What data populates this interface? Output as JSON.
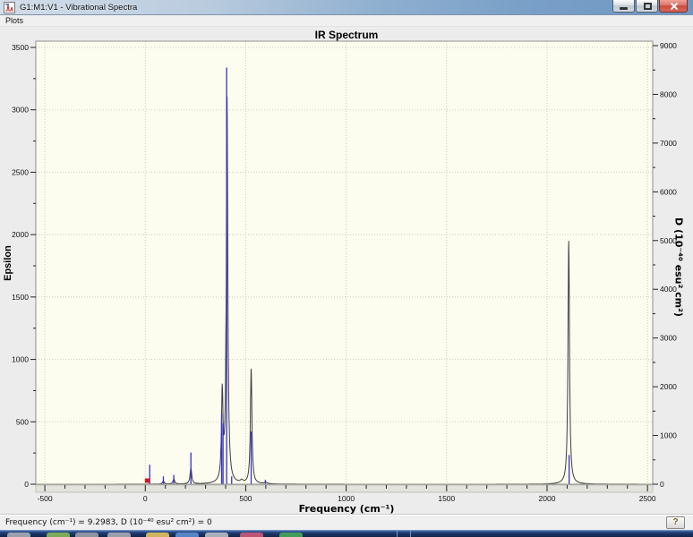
{
  "window": {
    "title": "G1:M1:V1 - Vibrational Spectra"
  },
  "menu": {
    "items": [
      {
        "label": "Plots"
      }
    ]
  },
  "status_bar": {
    "text": "Frequency (cm⁻¹) = 9.2983, D (10⁻⁴⁰ esu² cm²) = 0",
    "help_label": "?"
  },
  "chart_data": {
    "type": "line",
    "title": "IR Spectrum",
    "xlabel": "Frequency (cm⁻¹)",
    "ylabel_left": "Epsilon",
    "ylabel_right": "D (10⁻⁴⁰ esu² cm²)",
    "x_range": [
      -545,
      2526
    ],
    "eps_range": [
      0,
      3550
    ],
    "d_range": [
      0,
      9092
    ],
    "x_ticks": [
      -500,
      0,
      500,
      1000,
      1500,
      2000,
      2500
    ],
    "x_minor_step": 100,
    "eps_ticks": [
      0,
      500,
      1000,
      1500,
      2000,
      2500,
      3000,
      3500
    ],
    "eps_minor_step": 250,
    "d_ticks": [
      0,
      1000,
      2000,
      3000,
      4000,
      5000,
      6000,
      7000,
      8000,
      9000
    ],
    "d_minor_step": 500,
    "grid": true,
    "legend": "none",
    "series": [
      {
        "name": "epsilon-curve",
        "type": "lorentzian-sum",
        "axis": "left",
        "color": "#3f3f3f",
        "peaks": [
          {
            "freq": 90,
            "eps": 25,
            "hwhm": 5
          },
          {
            "freq": 142,
            "eps": 40,
            "hwhm": 5
          },
          {
            "freq": 227,
            "eps": 125,
            "hwhm": 5
          },
          {
            "freq": 383,
            "eps": 700,
            "hwhm": 4.5
          },
          {
            "freq": 407,
            "eps": 3080,
            "hwhm": 4.5
          },
          {
            "freq": 480,
            "eps": 20,
            "hwhm": 8
          },
          {
            "freq": 527,
            "eps": 920,
            "hwhm": 4.5
          },
          {
            "freq": 600,
            "eps": 12,
            "hwhm": 8
          },
          {
            "freq": 2108,
            "eps": 1950,
            "hwhm": 4.5
          }
        ]
      },
      {
        "name": "d-sticks",
        "type": "stick",
        "axis": "right",
        "color": "#3232c8",
        "sticks": [
          {
            "freq": 22,
            "d": 400
          },
          {
            "freq": 90,
            "d": 160
          },
          {
            "freq": 142,
            "d": 190
          },
          {
            "freq": 227,
            "d": 650
          },
          {
            "freq": 380,
            "d": 1450
          },
          {
            "freq": 387,
            "d": 1250
          },
          {
            "freq": 405,
            "d": 8550
          },
          {
            "freq": 430,
            "d": 160
          },
          {
            "freq": 527,
            "d": 1080
          },
          {
            "freq": 598,
            "d": 90
          },
          {
            "freq": 2110,
            "d": 600
          }
        ]
      }
    ],
    "cursor_marker": {
      "freq": 9.2983,
      "d": 0,
      "color": "#e11212"
    },
    "colors": {
      "plot_bg": "#fcfcef",
      "grid": "#c9c9bf",
      "panel_bg": "#ececec",
      "plot_border": "#8f8f88",
      "tick_band": "#e3e3dd"
    }
  },
  "taskbar": {
    "icon_colors": [
      "#a8adb5",
      "#86b95a",
      "#9aa0a8",
      "#a8adb5",
      "#e3c25e",
      "#5b8fd4",
      "#b9bec5",
      "#cc5a78",
      "#49a85c"
    ]
  }
}
